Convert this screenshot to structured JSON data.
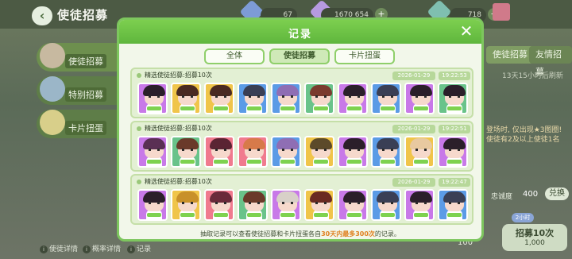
{
  "background": {
    "page_title": "使徒招募",
    "resources": [
      "67",
      "1670 654",
      "718"
    ],
    "side_tabs": [
      "使徒招募",
      "特别招募",
      "卡片扭蛋"
    ],
    "right_tabs": [
      "使徒招募",
      "友情招募"
    ],
    "refresh_note": "13天15小时后刷新",
    "promo_text_1": "登场时, 仅出现★3图圈!",
    "promo_text_2": "使徒有2及以上使徒1名",
    "points_label": "忠诚度",
    "points_value": "400",
    "exchange_label": "兑换",
    "badge_text": "2小时",
    "recruit10_label": "招募10次",
    "recruit10_cost": "1,000",
    "cost_left": "100",
    "footer_links": [
      "使徒详情",
      "概率详情",
      "记录"
    ]
  },
  "modal": {
    "title": "记录",
    "tabs": [
      {
        "label": "全体",
        "active": false
      },
      {
        "label": "使徒招募",
        "active": true
      },
      {
        "label": "卡片扭蛋",
        "active": false
      }
    ],
    "records": [
      {
        "title": "精选使徒招募:招募10次",
        "date": "2026-01-29",
        "time": "19:22:53",
        "cards": [
          {
            "bg": "#c879e8",
            "hair": "#2b1f2a",
            "face": "#f6d9cc"
          },
          {
            "bg": "#f0c54a",
            "hair": "#4a2a22",
            "face": "#f6d9cc"
          },
          {
            "bg": "#f0c54a",
            "hair": "#4a2a22",
            "face": "#f6d9cc"
          },
          {
            "bg": "#5b9be6",
            "hair": "#3a3f55",
            "face": "#f6d9cc"
          },
          {
            "bg": "#5b9be6",
            "hair": "#8f6eb4",
            "face": "#f6d9cc"
          },
          {
            "bg": "#69c38a",
            "hair": "#7a3b2e",
            "face": "#f6d9cc"
          },
          {
            "bg": "#c879e8",
            "hair": "#2b1f2a",
            "face": "#f6d9cc"
          },
          {
            "bg": "#5b9be6",
            "hair": "#3a3f55",
            "face": "#f6d9cc"
          },
          {
            "bg": "#c879e8",
            "hair": "#2b1f2a",
            "face": "#f6d9cc"
          },
          {
            "bg": "#69c38a",
            "hair": "#2b1f2a",
            "face": "#f6d9cc"
          }
        ]
      },
      {
        "title": "精选使徒招募:招募10次",
        "date": "2026-01-29",
        "time": "19:22:51",
        "cards": [
          {
            "bg": "#c879e8",
            "hair": "#5a2f54",
            "face": "#f6d9cc"
          },
          {
            "bg": "#69c38a",
            "hair": "#6a3a2a",
            "face": "#f6d9cc"
          },
          {
            "bg": "#f07a8e",
            "hair": "#5a2433",
            "face": "#f6d9cc"
          },
          {
            "bg": "#f07a8e",
            "hair": "#d77a4a",
            "face": "#f6d9cc"
          },
          {
            "bg": "#5b9be6",
            "hair": "#8f6eb4",
            "face": "#f6d9cc"
          },
          {
            "bg": "#f0c54a",
            "hair": "#5c4a2a",
            "face": "#f6d9cc"
          },
          {
            "bg": "#c879e8",
            "hair": "#2b1f2a",
            "face": "#f6d9cc"
          },
          {
            "bg": "#5b9be6",
            "hair": "#3a3f55",
            "face": "#f6d9cc"
          },
          {
            "bg": "#f0c54a",
            "hair": "#e8c9a0",
            "face": "#f6d9cc"
          },
          {
            "bg": "#c879e8",
            "hair": "#2b1f2a",
            "face": "#f6d9cc"
          }
        ]
      },
      {
        "title": "精选使徒招募:招募10次",
        "date": "2026-01-29",
        "time": "19:22:47",
        "cards": [
          {
            "bg": "#c879e8",
            "hair": "#2b1f2a",
            "face": "#f6d9cc"
          },
          {
            "bg": "#f0c54a",
            "hair": "#c8902a",
            "face": "#f6d9cc"
          },
          {
            "bg": "#f07a8e",
            "hair": "#6a2a3a",
            "face": "#f6d9cc"
          },
          {
            "bg": "#69c38a",
            "hair": "#6a3a2a",
            "face": "#f6d9cc"
          },
          {
            "bg": "#c879e8",
            "hair": "#d8d0c8",
            "face": "#f6d9cc"
          },
          {
            "bg": "#f0c54a",
            "hair": "#6a2a22",
            "face": "#f6d9cc"
          },
          {
            "bg": "#c879e8",
            "hair": "#2b1f2a",
            "face": "#f6d9cc"
          },
          {
            "bg": "#5b9be6",
            "hair": "#3a3f55",
            "face": "#f6d9cc"
          },
          {
            "bg": "#c879e8",
            "hair": "#2b1f2a",
            "face": "#f6d9cc"
          },
          {
            "bg": "#5b9be6",
            "hair": "#3a3f55",
            "face": "#f6d9cc"
          }
        ]
      }
    ],
    "footer": {
      "prefix": "抽取记录可以查看使徒招募和卡片扭蛋各自",
      "highlight": "30天内最多300次",
      "suffix": "的记录。"
    }
  },
  "colors": {
    "accent": "#6cc24a",
    "modal_bg": "#f2f7ea",
    "highlight": "#e0801f"
  }
}
